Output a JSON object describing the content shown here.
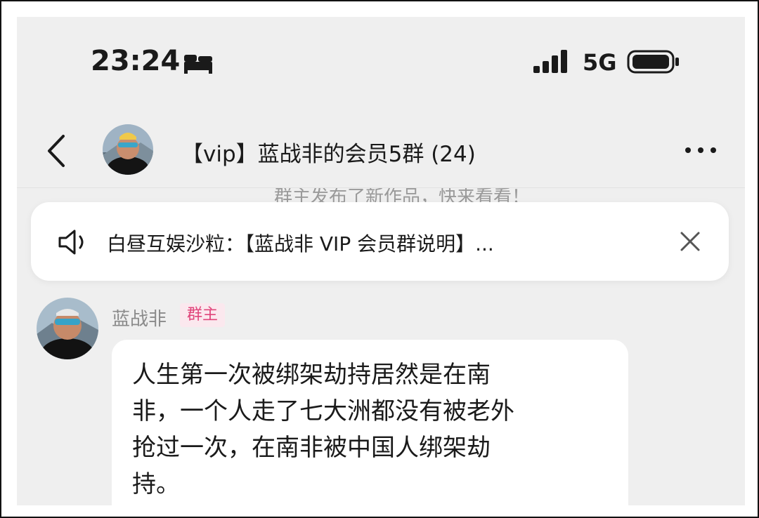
{
  "status_bar": {
    "time": "23:24",
    "sleep_icon": "bed-icon",
    "signal_icon": "cellular-signal-icon",
    "network": "5G",
    "battery_icon": "battery-icon"
  },
  "header": {
    "back_icon": "chevron-left-icon",
    "title": "【vip】蓝战非的会员5群 (24)",
    "more_icon": "more-dots-icon"
  },
  "system_notice": "群主发布了新作品，快来看看！",
  "announcement": {
    "icon": "speaker-icon",
    "text": "白昼互娱沙粒：【蓝战非 VIP 会员群说明】...",
    "close_icon": "close-icon"
  },
  "message": {
    "sender_name": "蓝战非",
    "role_badge": "群主",
    "text": "人生第一次被绑架劫持居然是在南\n非，一个人走了七大洲都没有被老外\n抢过一次，在南非被中国人绑架劫\n持。"
  },
  "colors": {
    "background": "#efefef",
    "card": "#ffffff",
    "badge_text": "#e0457b",
    "badge_bg": "#fbe8ee",
    "muted_text": "#8a8a8a"
  }
}
